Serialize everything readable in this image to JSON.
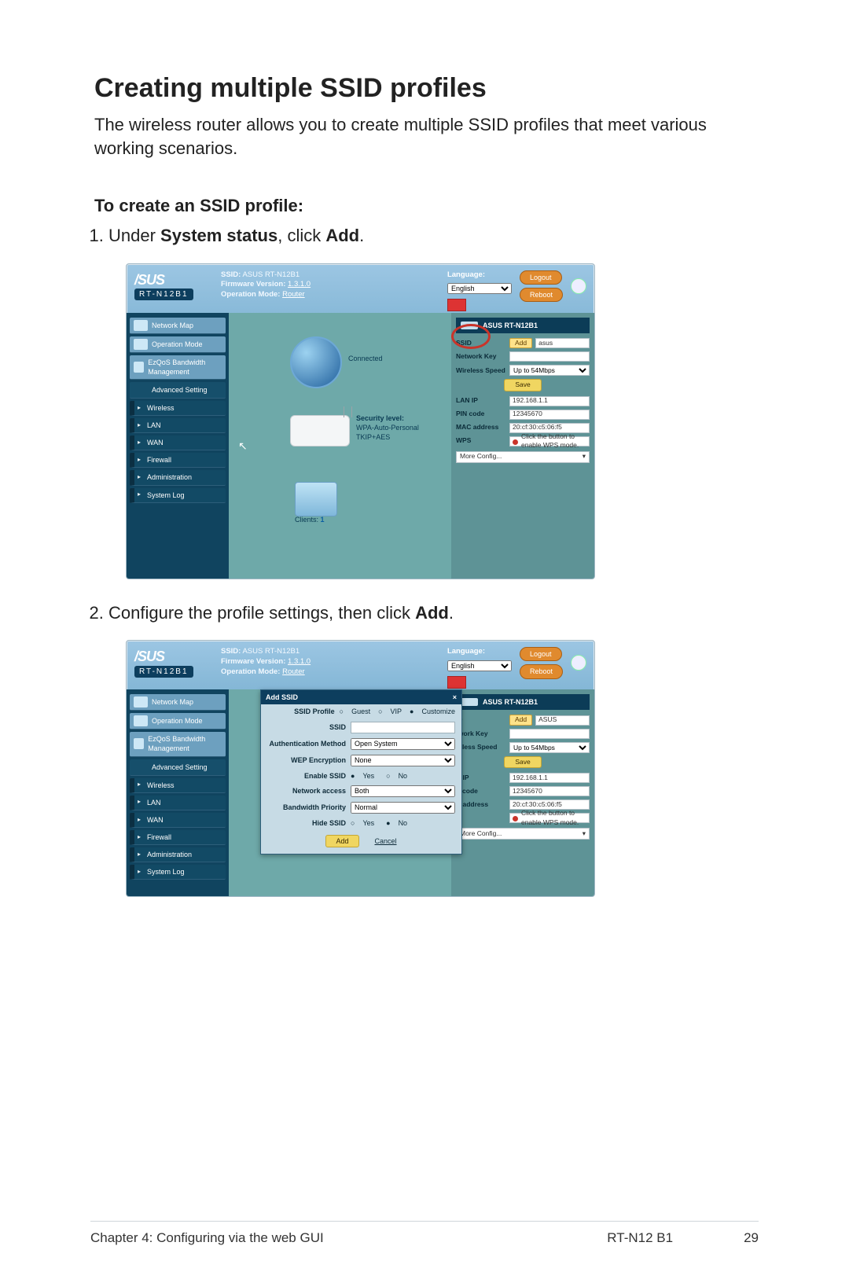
{
  "doc": {
    "heading": "Creating multiple SSID profiles",
    "intro": "The wireless router allows you to create multiple SSID profiles that meet various working scenarios.",
    "subhead": "To create an SSID profile:",
    "steps": [
      {
        "pre": "Under ",
        "b1": "System status",
        "mid": ", click ",
        "b2": "Add",
        "post": "."
      },
      {
        "pre": "Configure the profile settings, then click ",
        "b1": "Add",
        "mid": "",
        "b2": "",
        "post": "."
      }
    ],
    "footer": {
      "left": "Chapter 4: Configuring via the web GUI",
      "mid": "RT-N12 B1",
      "right": "29"
    }
  },
  "ui": {
    "brand": "/SUS",
    "model": "RT-N12B1",
    "meta": {
      "ssid_k": "SSID:",
      "ssid_v": "ASUS RT-N12B1",
      "fw_k": "Firmware Version:",
      "fw_v": "1.3.1.0",
      "op_k": "Operation Mode:",
      "op_v": "Router"
    },
    "lang": {
      "label": "Language:",
      "value": "English"
    },
    "buttons": {
      "logout": "Logout",
      "reboot": "Reboot"
    },
    "sidebar": {
      "main": [
        "Network Map",
        "Operation Mode",
        "EzQoS Bandwidth Management"
      ],
      "adv": "Advanced Setting",
      "sub": [
        "Wireless",
        "LAN",
        "WAN",
        "Firewall",
        "Administration",
        "System Log"
      ]
    },
    "mid": {
      "connected": "Connected",
      "sec_label": "Security level:",
      "sec_value": "WPA-Auto-Personal TKIP+AES",
      "clients_label": "Clients:",
      "clients_value": "1"
    },
    "right": {
      "title": "ASUS RT-N12B1",
      "ssid_k": "SSID",
      "ssid_add": "Add",
      "ssid_val": "asus",
      "netkey_k": "Network Key",
      "speed_k": "Wireless Speed",
      "speed_v": "Up to 54Mbps",
      "save": "Save",
      "lanip_k": "LAN IP",
      "lanip_v": "192.168.1.1",
      "pin_k": "PIN code",
      "pin_v": "12345670",
      "mac_k": "MAC address",
      "mac_v": "20:cf:30:c5:06:f5",
      "wps_k": "WPS",
      "wps_note": "Click the button to enable WPS mode.",
      "more": "More Config..."
    },
    "dialog": {
      "title": "Add SSID",
      "close": "×",
      "profile_k": "SSID Profile",
      "p1": "Guest",
      "p2": "VIP",
      "p3": "Customize",
      "ssid_k": "SSID",
      "auth_k": "Authentication Method",
      "auth_v": "Open System",
      "wep_k": "WEP Encryption",
      "wep_v": "None",
      "enable_k": "Enable SSID",
      "yes": "Yes",
      "no": "No",
      "net_k": "Network access",
      "net_v": "Both",
      "bw_k": "Bandwidth Priority",
      "bw_v": "Normal",
      "hide_k": "Hide SSID",
      "add": "Add",
      "cancel": "Cancel"
    }
  }
}
